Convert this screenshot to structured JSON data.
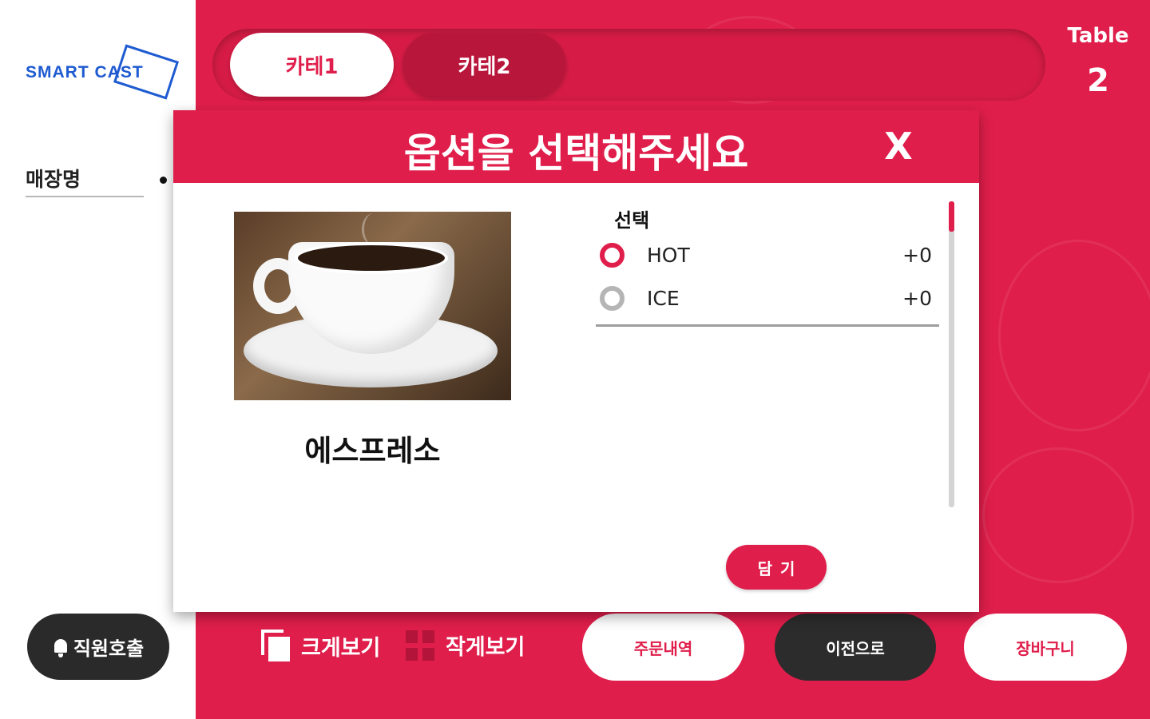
{
  "brand": {
    "logo_text": "SMART CAST"
  },
  "sidebar": {
    "store_name": "매장명",
    "staff_call_label": "직원호출"
  },
  "tabs": [
    {
      "label": "카테1",
      "selected": true
    },
    {
      "label": "카테2",
      "selected": false
    }
  ],
  "table": {
    "label": "Table",
    "number": "2"
  },
  "modal": {
    "title": "옵션을 선택해주세요",
    "close_label": "X",
    "product_name": "에스프레소",
    "option_group": "선택",
    "options": [
      {
        "label": "HOT",
        "price": "+0",
        "selected": true
      },
      {
        "label": "ICE",
        "price": "+0",
        "selected": false
      }
    ],
    "add_label": "담기"
  },
  "bottom": {
    "view_large_label": "크게보기",
    "view_small_label": "작게보기",
    "order_history_label": "주문내역",
    "back_label": "이전으로",
    "cart_label": "장바구니"
  },
  "colors": {
    "accent": "#e01e4b",
    "dark": "#2c2c2c"
  }
}
